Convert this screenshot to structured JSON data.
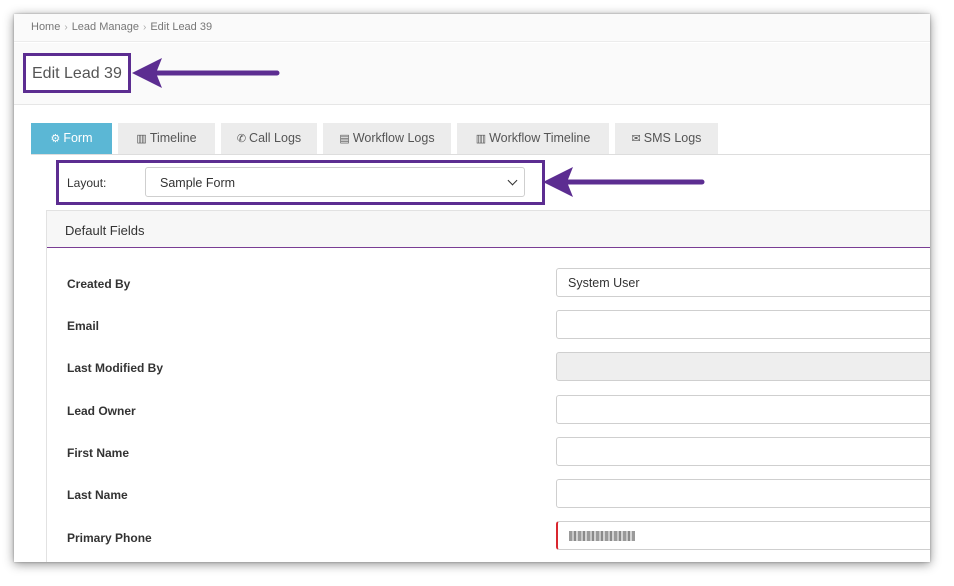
{
  "breadcrumb": [
    "Home",
    "Lead Manage",
    "Edit Lead 39"
  ],
  "page_title": "Edit Lead 39",
  "tabs": [
    {
      "label": "Form",
      "icon": "gears-icon",
      "active": true
    },
    {
      "label": "Timeline",
      "icon": "bar-chart-icon",
      "active": false
    },
    {
      "label": "Call Logs",
      "icon": "phone-icon",
      "active": false
    },
    {
      "label": "Workflow Logs",
      "icon": "document-icon",
      "active": false
    },
    {
      "label": "Workflow Timeline",
      "icon": "bar-chart-icon",
      "active": false
    },
    {
      "label": "SMS Logs",
      "icon": "envelope-icon",
      "active": false
    }
  ],
  "layout": {
    "label": "Layout:",
    "selected": "Sample Form"
  },
  "panel": {
    "title": "Default Fields"
  },
  "fields": [
    {
      "label": "Created By",
      "value": "System User",
      "disabled": false
    },
    {
      "label": "Email",
      "value": "",
      "disabled": false
    },
    {
      "label": "Last Modified By",
      "value": "",
      "disabled": true
    },
    {
      "label": "Lead Owner",
      "value": "",
      "disabled": false
    },
    {
      "label": "First Name",
      "value": "",
      "disabled": false
    },
    {
      "label": "Last Name",
      "value": "",
      "disabled": false
    },
    {
      "label": "Primary Phone",
      "value": "",
      "disabled": false,
      "required": true
    }
  ],
  "colors": {
    "accent": "#5bb7d5",
    "annotation": "#5c2d91",
    "required": "#d9262f"
  }
}
